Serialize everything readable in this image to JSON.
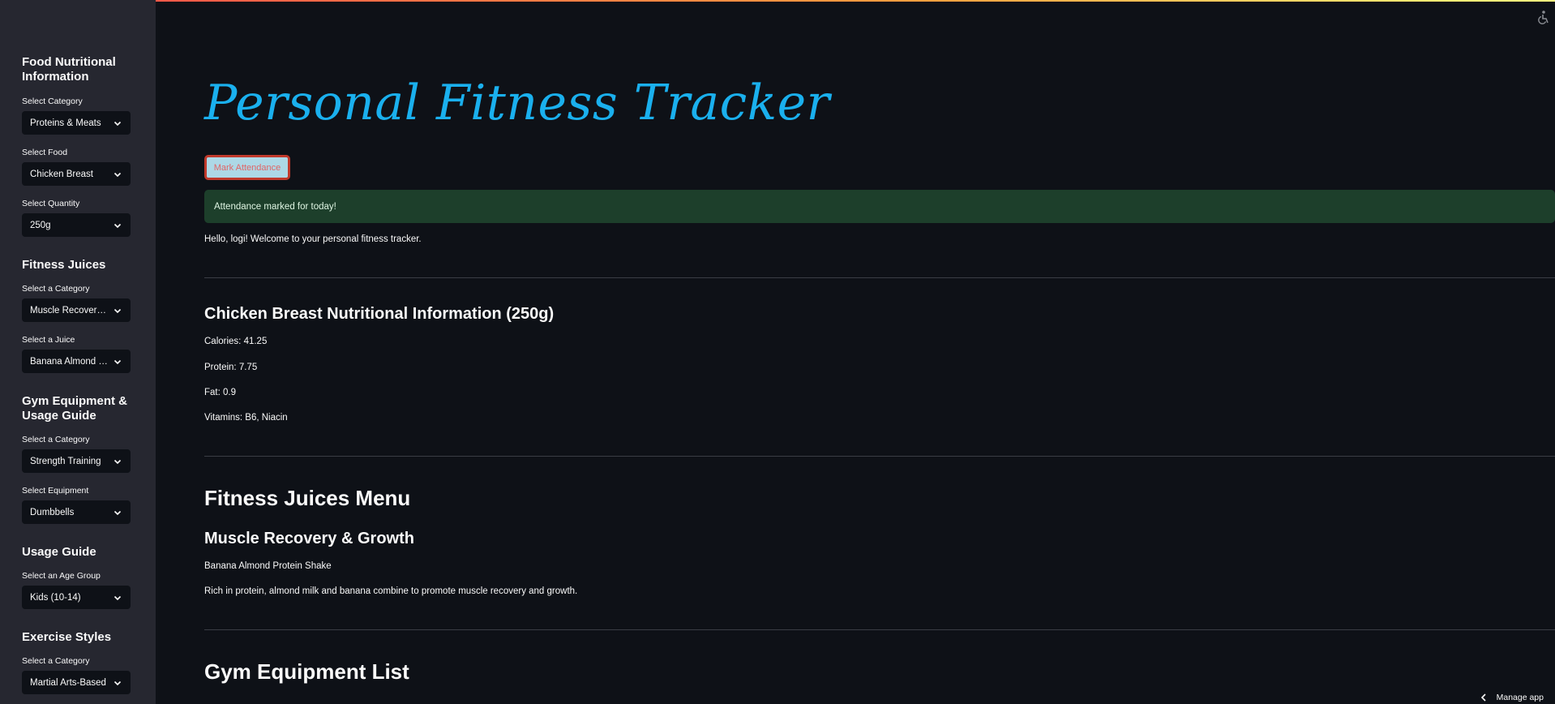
{
  "app": {
    "title": "Personal Fitness Tracker",
    "manage_app": "Manage app"
  },
  "sidebar": {
    "food": {
      "heading": "Food Nutritional Information",
      "category_label": "Select Category",
      "category_value": "Proteins & Meats",
      "food_label": "Select Food",
      "food_value": "Chicken Breast",
      "quantity_label": "Select Quantity",
      "quantity_value": "250g"
    },
    "juices": {
      "heading": "Fitness Juices",
      "category_label": "Select a Category",
      "category_value": "Muscle Recovery & Growth",
      "juice_label": "Select a Juice",
      "juice_value": "Banana Almond Protein Shake"
    },
    "gym": {
      "heading": "Gym Equipment & Usage Guide",
      "category_label": "Select a Category",
      "category_value": "Strength Training",
      "equipment_label": "Select Equipment",
      "equipment_value": "Dumbbells"
    },
    "usage": {
      "heading": "Usage Guide",
      "age_label": "Select an Age Group",
      "age_value": "Kids (10-14)"
    },
    "exercise": {
      "heading": "Exercise Styles",
      "category_label": "Select a Category",
      "category_value": "Martial Arts-Based"
    }
  },
  "main": {
    "attendance_button": "Mark Attendance",
    "attendance_success": "Attendance marked for today!",
    "welcome": "Hello, logi! Welcome to your personal fitness tracker.",
    "nutrition": {
      "heading": "Chicken Breast Nutritional Information (250g)",
      "calories": "Calories: 41.25",
      "protein": "Protein: 7.75",
      "fat": "Fat: 0.9",
      "vitamins": "Vitamins: B6, Niacin"
    },
    "juices_menu": {
      "heading": "Fitness Juices Menu",
      "subheading": "Muscle Recovery & Growth",
      "juice_name": "Banana Almond Protein Shake",
      "juice_desc": "Rich in protein, almond milk and banana combine to promote muscle recovery and growth."
    },
    "gym_list": {
      "heading": "Gym Equipment List"
    }
  },
  "colors": {
    "background": "#0e1117",
    "sidebar": "#262730",
    "title": "#1ab0ee",
    "success_bg": "#1d3f2b"
  }
}
